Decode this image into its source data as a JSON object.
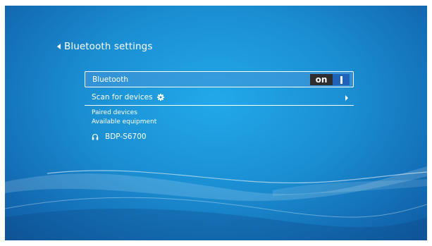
{
  "header": {
    "title": "Bluetooth settings"
  },
  "settings": {
    "bluetooth": {
      "label": "Bluetooth",
      "state": "on"
    },
    "scan": {
      "label": "Scan for devices"
    },
    "paired_label": "Paired devices",
    "available_label": "Available equipment",
    "devices": [
      {
        "name": "BDP-S6700"
      }
    ]
  },
  "icons": {
    "back": "chevron-left-icon",
    "scan": "gear-icon",
    "scan_arrow": "chevron-right-icon",
    "device": "headphones-icon"
  },
  "colors": {
    "background_center": "#22a9ea",
    "background_edge": "#0f5b9f",
    "toggle_label_bg": "#2e2e2e",
    "toggle_knob_bg": "#1e63b8"
  }
}
